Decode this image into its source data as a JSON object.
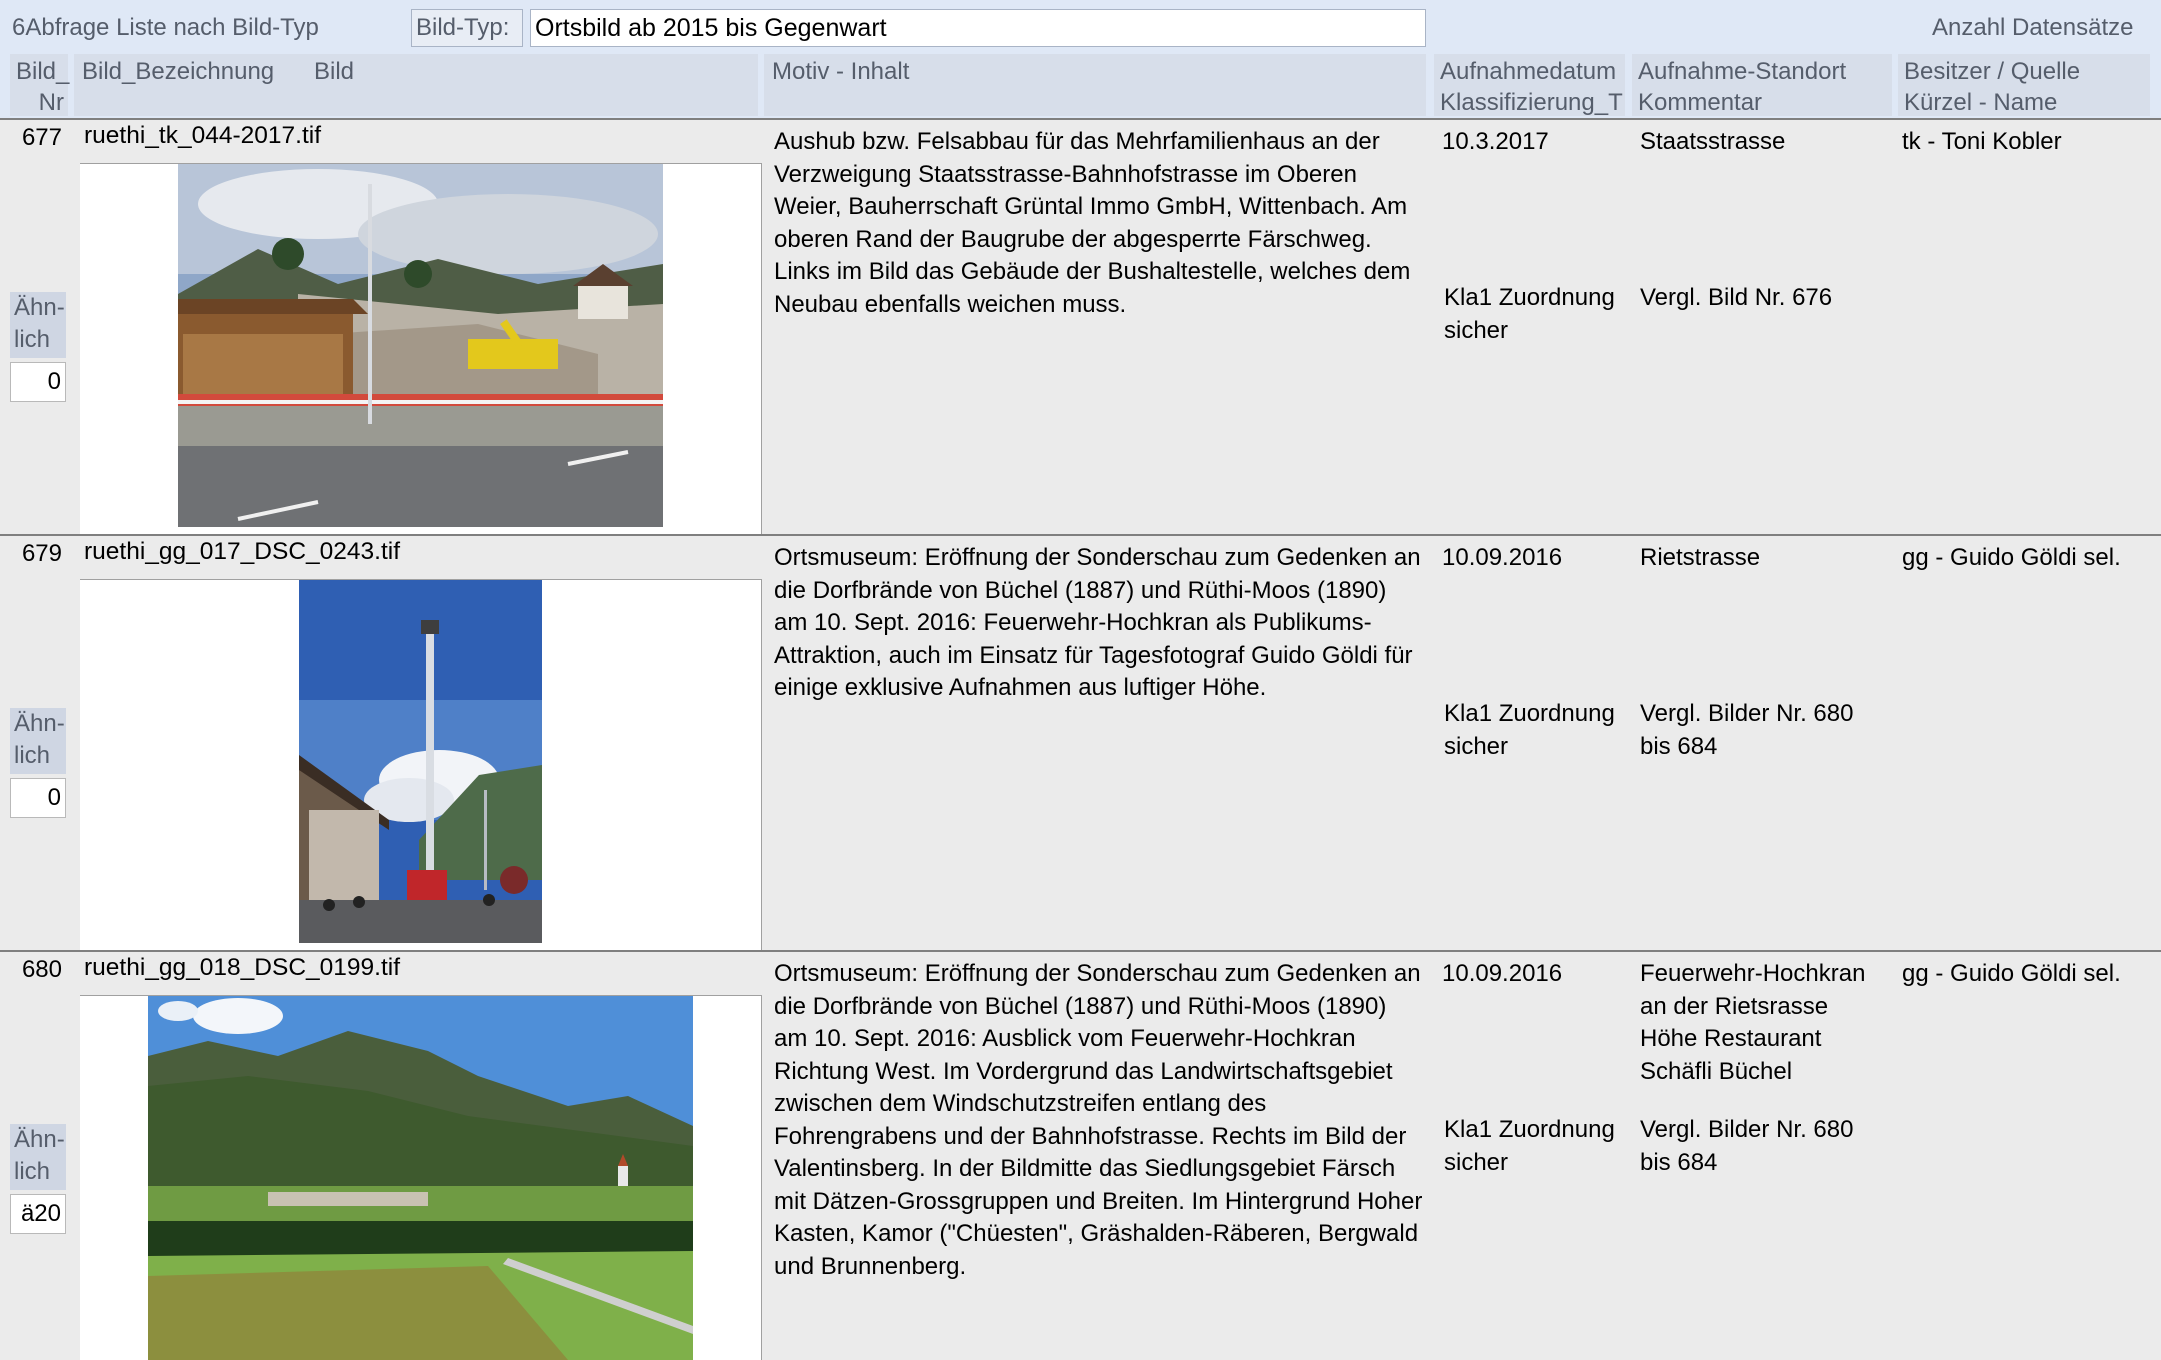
{
  "header": {
    "query_title": "6Abfrage Liste nach Bild-Typ",
    "bildtyp_label": "Bild-Typ:",
    "bildtyp_value": "Ortsbild ab 2015 bis Gegenwart",
    "count_label": "Anzahl Datensätze",
    "columns": {
      "nr_line1": "Bild_",
      "nr_line2": "Nr",
      "bezeichnung": "Bild_Bezeichnung",
      "bild": "Bild",
      "motiv": "Motiv - Inhalt",
      "datum_line1": "Aufnahmedatum",
      "datum_line2": "Klassifizierung_T",
      "standort_line1": "Aufnahme-Standort",
      "standort_line2": "Kommentar",
      "besitzer_line1": "Besitzer / Quelle",
      "besitzer_line2": "Kürzel - Name"
    }
  },
  "records": [
    {
      "nr": "677",
      "bezeichnung": "ruethi_tk_044-2017.tif",
      "motiv": "Aushub bzw. Felsabbau für das Mehrfamilienhaus an der Verzweigung Staatsstrasse-Bahnhofstrasse im Oberen Weier, Bauherrschaft Grüntal Immo GmbH, Wittenbach. Am oberen Rand der Baugrube der abgesperrte Färschweg. Links im Bild das Gebäude der Bushaltestelle, welches dem Neubau ebenfalls weichen muss.",
      "datum": "10.3.2017",
      "klass": "Kla1 Zuordnung sicher",
      "standort": "Staatsstrasse",
      "kommentar": "Vergl. Bild Nr. 676",
      "besitzer": "tk - Toni Kobler",
      "aehnlich_label": "Ähn-lich",
      "aehnlich_value": "0",
      "photo_icon": "construction-site-photo"
    },
    {
      "nr": "679",
      "bezeichnung": "ruethi_gg_017_DSC_0243.tif",
      "motiv": "Ortsmuseum: Eröffnung der Sonderschau zum Gedenken an die Dorfbrände von Büchel (1887) und Rüthi-Moos (1890) am 10. Sept. 2016: Feuerwehr-Hochkran als Publikums-Attraktion, auch im Einsatz für Tagesfotograf Guido Göldi für einige exklusive Aufnahmen aus luftiger Höhe.",
      "datum": "10.09.2016",
      "klass": "Kla1 Zuordnung sicher",
      "standort": "Rietstrasse",
      "kommentar": "Vergl. Bilder Nr. 680 bis 684",
      "besitzer": "gg - Guido Göldi sel.",
      "aehnlich_label": "Ähn-lich",
      "aehnlich_value": "0",
      "photo_icon": "fire-crane-photo"
    },
    {
      "nr": "680",
      "bezeichnung": "ruethi_gg_018_DSC_0199.tif",
      "motiv": "Ortsmuseum: Eröffnung der Sonderschau zum Gedenken an die Dorfbrände von Büchel (1887) und Rüthi-Moos (1890) am 10. Sept. 2016: Ausblick vom Feuerwehr-Hochkran Richtung West. Im Vordergrund das Landwirtschaftsgebiet zwischen dem Windschutzstreifen entlang des Fohrengrabens und der Bahnhofstrasse. Rechts im Bild der Valentinsberg. In der Bildmitte das Siedlungsgebiet Färsch mit Dätzen-Grossgruppen und Breiten. Im Hintergrund Hoher Kasten, Kamor (\"Chüesten\", Gräshalden-Räberen, Bergwald und Brunnenberg.",
      "datum": "10.09.2016",
      "klass": "Kla1 Zuordnung sicher",
      "standort": "Feuerwehr-Hochkran an der Rietsrasse Höhe Restaurant Schäfli Büchel",
      "kommentar": "Vergl. Bilder Nr. 680 bis 684",
      "besitzer": "gg - Guido Göldi sel.",
      "aehnlich_label": "Ähn-lich",
      "aehnlich_value": "ä20",
      "photo_icon": "valley-landscape-photo"
    }
  ],
  "colors": {
    "header_bg": "#dfe8f6",
    "header_text": "#555d6b",
    "record_bg": "#ebebeb",
    "separator": "#7f7f7f"
  }
}
